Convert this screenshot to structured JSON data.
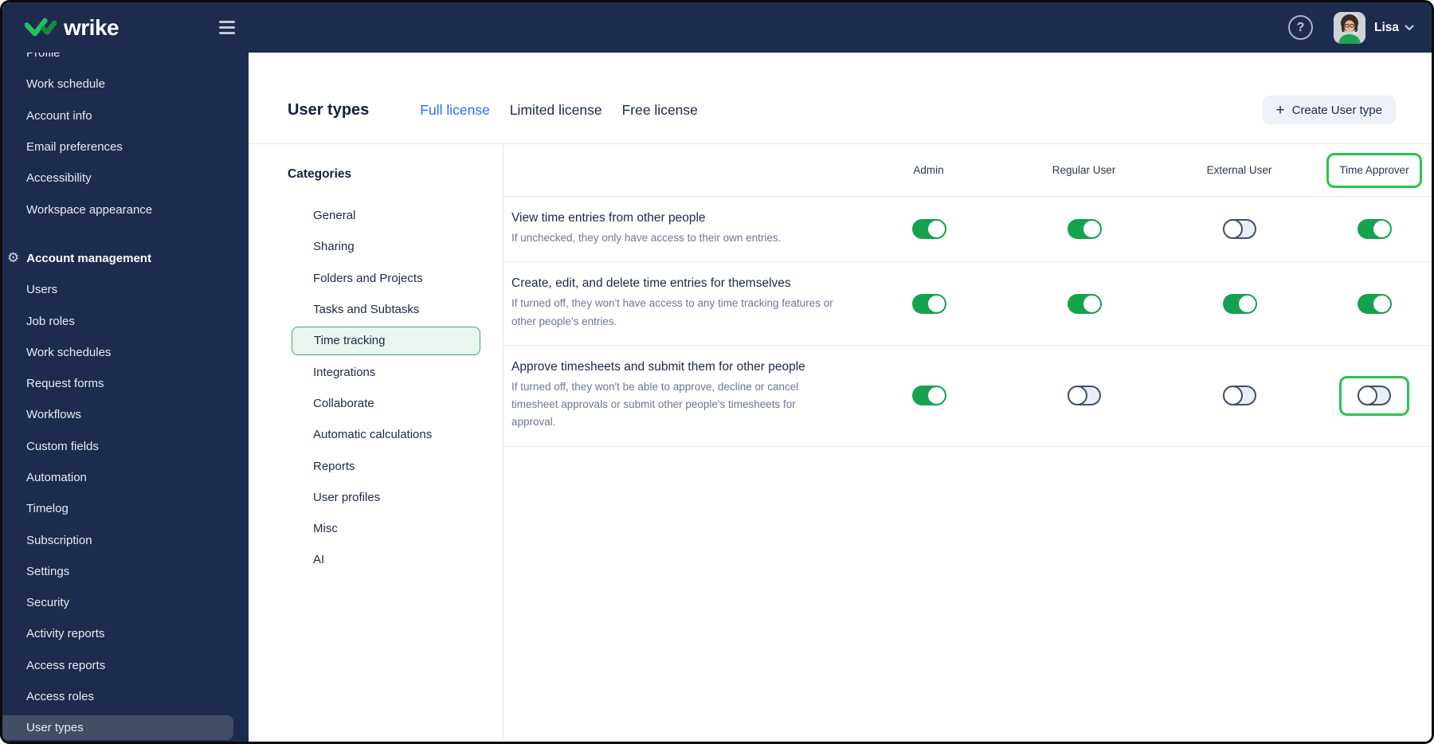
{
  "topbar": {
    "brand": "wrike",
    "help_label": "?",
    "user": {
      "name": "Lisa"
    }
  },
  "icons": {
    "logo": "wrike-double-checkmark",
    "menu": "hamburger",
    "help": "question-mark-circle",
    "user_chevron": "chevron-down",
    "section_gear": "⚙",
    "plus": "+"
  },
  "sidebar": {
    "personal_items": [
      "Profile",
      "Work schedule",
      "Account info",
      "Email preferences",
      "Accessibility",
      "Workspace appearance"
    ],
    "section_label": "Account management",
    "admin_items": [
      "Users",
      "Job roles",
      "Work schedules",
      "Request forms",
      "Workflows",
      "Custom fields",
      "Automation",
      "Timelog",
      "Subscription",
      "Settings",
      "Security",
      "Activity reports",
      "Access reports",
      "Access roles",
      "User types"
    ],
    "active_item": "User types"
  },
  "header": {
    "title": "User types",
    "tabs": [
      {
        "label": "Full license",
        "active": true
      },
      {
        "label": "Limited license",
        "active": false
      },
      {
        "label": "Free license",
        "active": false
      }
    ],
    "create_button": {
      "icon": "+",
      "label": "Create User type"
    }
  },
  "categories": {
    "title": "Categories",
    "items": [
      "General",
      "Sharing",
      "Folders and Projects",
      "Tasks and Subtasks",
      "Time tracking",
      "Integrations",
      "Collaborate",
      "Automatic calculations",
      "Reports",
      "User profiles",
      "Misc",
      "AI"
    ],
    "active_item": "Time tracking"
  },
  "permissions": {
    "columns": [
      "Admin",
      "Regular User",
      "External User",
      "Time Approver"
    ],
    "highlighted_column": "Time Approver",
    "rows": [
      {
        "title": "View time entries from other people",
        "description": "If unchecked, they only have access to their own entries.",
        "toggles": [
          true,
          true,
          false,
          true
        ],
        "highlighted_toggle": null
      },
      {
        "title": "Create, edit, and delete time entries for themselves",
        "description": "If turned off, they won't have access to any time tracking features or other people's entries.",
        "toggles": [
          true,
          true,
          true,
          true
        ],
        "highlighted_toggle": null
      },
      {
        "title": "Approve timesheets and submit them for other people",
        "description": "If turned off, they won't be able to approve, decline or cancel timesheet approvals or submit other people's timesheets for approval.",
        "toggles": [
          true,
          false,
          false,
          false
        ],
        "highlighted_toggle": 3
      }
    ]
  },
  "colors": {
    "sidebar_bg": "#1d2b4e",
    "brand_green": "#14a24d",
    "highlight_green": "#2bc34e",
    "active_tab_blue": "#2a6ff2",
    "category_active_bg": "#e9f5ee",
    "category_active_border": "#44a173",
    "toggle_off_bg": "#e9eef9",
    "toggle_off_border": "#454f6e",
    "active_nav_bg": "#424d66"
  }
}
